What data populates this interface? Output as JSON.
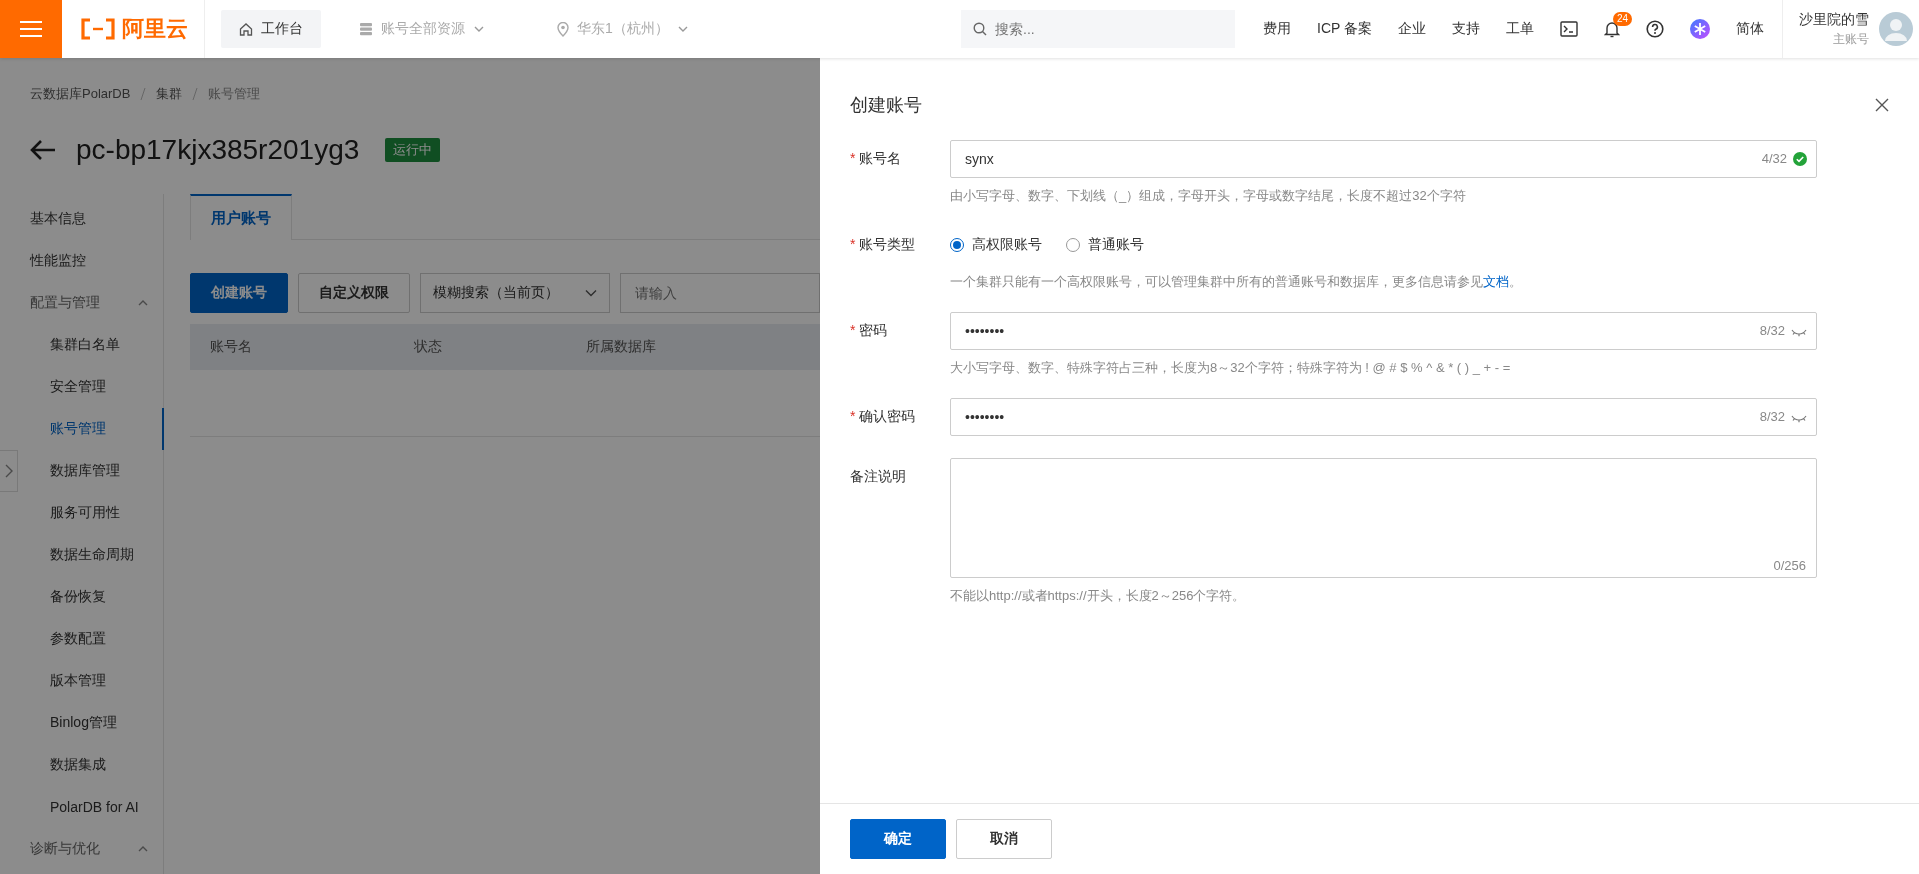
{
  "topbar": {
    "logo": "阿里云",
    "workbench": "工作台",
    "resource_scope": "账号全部资源",
    "region": "华东1（杭州）",
    "search": {
      "placeholder": "搜索..."
    },
    "links": [
      "费用",
      "ICP 备案",
      "企业",
      "支持",
      "工单"
    ],
    "notifications": "24",
    "language": "简体",
    "user": {
      "name": "沙里院的雪",
      "role": "主账号"
    }
  },
  "page": {
    "breadcrumb": [
      "云数据库PolarDB",
      "集群",
      "账号管理"
    ],
    "title": "pc-bp17kjx385r201yg3",
    "status": "运行中",
    "sidebar": [
      {
        "kind": "item",
        "label": "基本信息",
        "selected": false
      },
      {
        "kind": "item",
        "label": "性能监控",
        "selected": false
      },
      {
        "kind": "group",
        "label": "配置与管理",
        "expanded": true,
        "children": [
          {
            "label": "集群白名单",
            "selected": false
          },
          {
            "label": "安全管理",
            "selected": false
          },
          {
            "label": "账号管理",
            "selected": true
          },
          {
            "label": "数据库管理",
            "selected": false
          },
          {
            "label": "服务可用性",
            "selected": false
          },
          {
            "label": "数据生命周期",
            "selected": false
          },
          {
            "label": "备份恢复",
            "selected": false
          },
          {
            "label": "参数配置",
            "selected": false
          },
          {
            "label": "版本管理",
            "selected": false
          },
          {
            "label": "Binlog管理",
            "selected": false
          },
          {
            "label": "数据集成",
            "selected": false
          },
          {
            "label": "PolarDB for AI",
            "selected": false
          }
        ]
      },
      {
        "kind": "group",
        "label": "诊断与优化",
        "expanded": true
      }
    ],
    "tabs": [
      {
        "label": "用户账号",
        "selected": true
      }
    ],
    "toolbar": {
      "create": "创建账号",
      "custom": "自定义权限",
      "search_mode": "模糊搜索（当前页）",
      "search": {
        "placeholder": "请输入"
      }
    },
    "table": {
      "columns": [
        "账号名",
        "状态",
        "所属数据库"
      ]
    }
  },
  "drawer": {
    "title": "创建账号",
    "fields": [
      {
        "kind": "text",
        "required_mark": "*",
        "label": "账号名",
        "value": "synx",
        "counter": "4/32",
        "valid": true,
        "help": "由小写字母、数字、下划线（_）组成，字母开头，字母或数字结尾，长度不超过32个字符"
      },
      {
        "kind": "radio",
        "required_mark": "*",
        "label": "账号类型",
        "options": [
          {
            "label": "高权限账号",
            "selected": true
          },
          {
            "label": "普通账号",
            "selected": false
          }
        ],
        "help": "一个集群只能有一个高权限账号，可以管理集群中所有的普通账号和数据库，更多信息请参见",
        "help_link": "文档",
        "help_end": "。"
      },
      {
        "kind": "password",
        "required_mark": "*",
        "label": "密码",
        "value": "••••••••",
        "counter": "8/32",
        "visible": false,
        "help": "大小写字母、数字、特殊字符占三种，长度为8～32个字符；特殊字符为 ! @ # $ % ^ & * ( ) _ + - ="
      },
      {
        "kind": "password",
        "required_mark": "*",
        "label": "确认密码",
        "value": "••••••••",
        "counter": "8/32",
        "visible": false
      },
      {
        "kind": "textarea",
        "label": "备注说明",
        "counter": "0/256",
        "help": "不能以http://或者https://开头，长度2～256个字符。"
      }
    ],
    "buttons": {
      "confirm": "确定",
      "cancel": "取消"
    }
  }
}
